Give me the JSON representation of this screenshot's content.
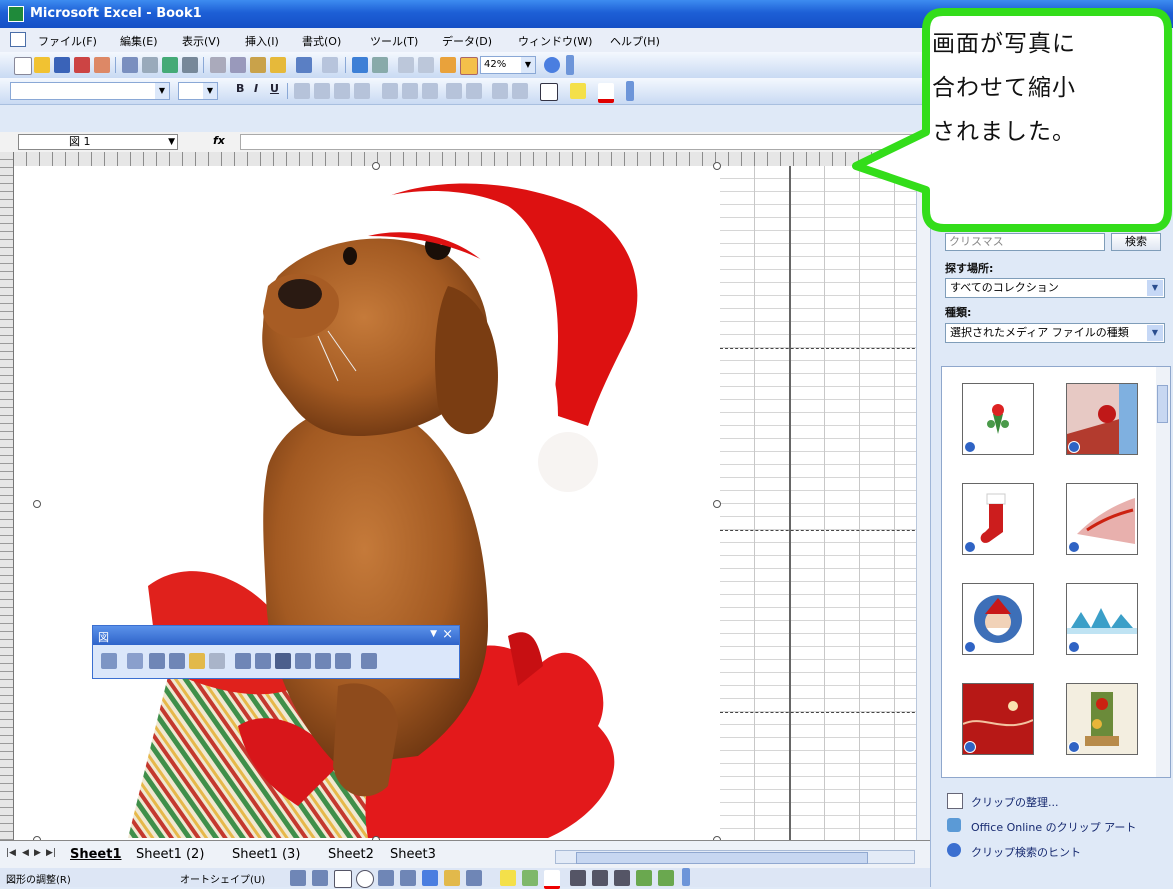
{
  "window": {
    "title": "Microsoft Excel - Book1"
  },
  "menu": [
    "ファイル(F)",
    "編集(E)",
    "表示(V)",
    "挿入(I)",
    "書式(O)",
    "ツール(T)",
    "データ(D)",
    "ウィンドウ(W)",
    "ヘルプ(H)"
  ],
  "toolbar": {
    "zoom": "42%"
  },
  "formula_bar": {
    "name_box": "図 1",
    "fx": "fx"
  },
  "picture_toolbar": {
    "title": "図"
  },
  "sheet_tabs": [
    "Sheet1",
    "Sheet1 (2)",
    "Sheet1 (3)",
    "Sheet2",
    "Sheet3"
  ],
  "drawing_toolbar": {
    "label": "図形の調整(R)",
    "autoshapes": "オートシェイプ(U)"
  },
  "task_pane": {
    "search_placeholder": "クリスマス",
    "search_button": "検索",
    "search_in_label": "探す場所:",
    "search_in_value": "すべてのコレクション",
    "type_label": "種類:",
    "type_value": "選択されたメディア ファイルの種類",
    "links": [
      "クリップの整理...",
      "Office Online のクリップ アート",
      "クリップ検索のヒント"
    ]
  },
  "callout": {
    "lines": [
      "画面が写真に",
      "合わせて縮小",
      "されました。"
    ]
  },
  "colors": {
    "title_blue": "#1d5fd6",
    "callout_green": "#33dd1a",
    "santa_red": "#dd1111"
  }
}
